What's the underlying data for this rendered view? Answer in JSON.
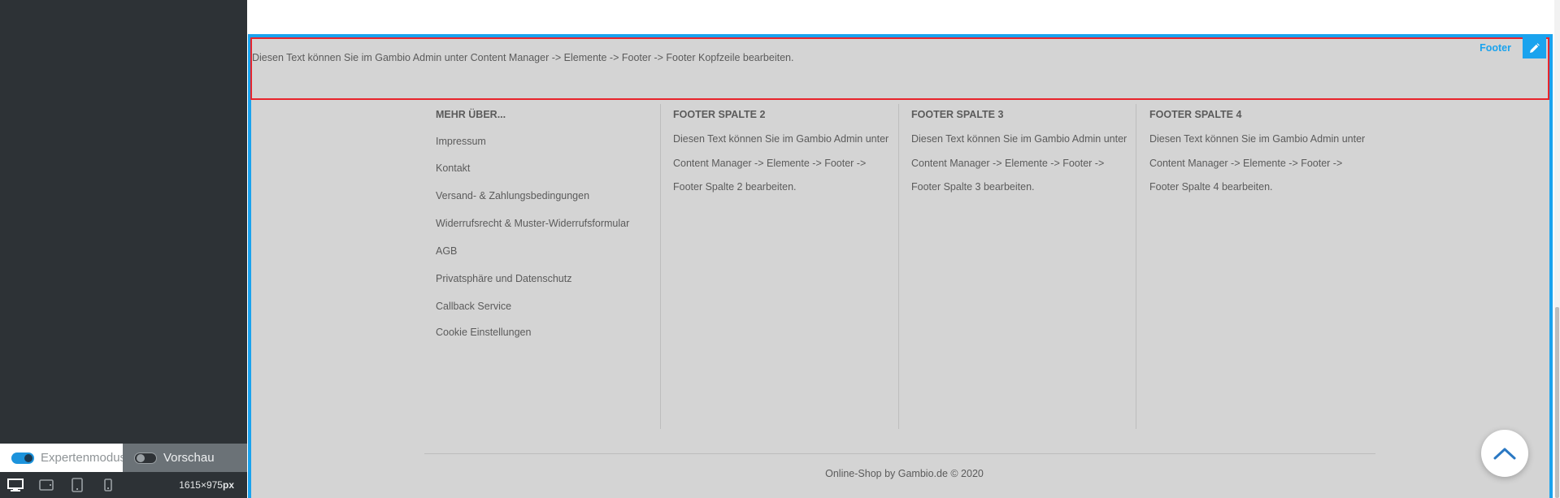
{
  "editor": {
    "expert_mode_label": "Expertenmodus",
    "preview_label": "Vorschau",
    "viewport": {
      "width": "1615",
      "times": "×",
      "height": "975",
      "unit": "px"
    },
    "devices": [
      "desktop-icon",
      "tablet-landscape-icon",
      "tablet-portrait-icon",
      "phone-icon"
    ]
  },
  "footer": {
    "zone_label": "Footer",
    "header_text": "Diesen Text können Sie im Gambio Admin unter Content Manager -> Elemente -> Footer -> Footer Kopfzeile bearbeiten.",
    "columns": [
      {
        "title": "MEHR ÜBER...",
        "links": [
          "Impressum",
          "Kontakt",
          "Versand- & Zahlungsbedingungen",
          "Widerrufsrecht & Muster-Widerrufsformular",
          "AGB",
          "Privatsphäre und Datenschutz",
          "Callback Service",
          "Cookie Einstellungen"
        ]
      },
      {
        "title": "FOOTER SPALTE 2",
        "text": "Diesen Text können Sie im Gambio Admin unter Content Manager -> Elemente -> Footer -> Footer Spalte 2 bearbeiten."
      },
      {
        "title": "FOOTER SPALTE 3",
        "text": "Diesen Text können Sie im Gambio Admin unter Content Manager -> Elemente -> Footer -> Footer Spalte 3 bearbeiten."
      },
      {
        "title": "FOOTER SPALTE 4",
        "text": "Diesen Text können Sie im Gambio Admin unter Content Manager -> Elemente -> Footer -> Footer Spalte 4 bearbeiten."
      }
    ],
    "copyright": "Online-Shop by Gambio.de © 2020"
  },
  "colors": {
    "accent": "#1aa3ee",
    "selection_border": "#e8242c",
    "sidebar_bg": "#2d3236",
    "footer_bg": "#d4d4d4"
  }
}
